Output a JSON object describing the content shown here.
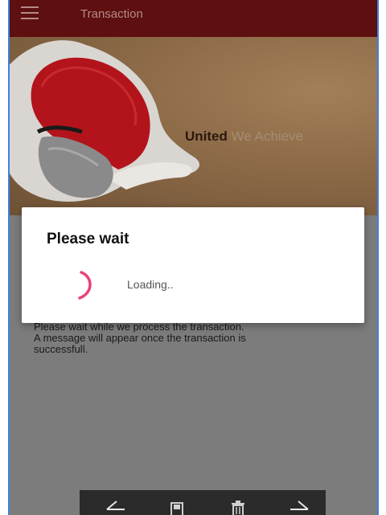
{
  "header": {
    "title": "Transaction"
  },
  "banner": {
    "tagline_part1": "United",
    "tagline_part2": "We Achieve"
  },
  "dialog": {
    "title": "Please wait",
    "loading_text": "Loading.."
  },
  "message": {
    "line1": "Please wait while we process the transaction.",
    "line2": "A message will appear once the transaction is",
    "line3": "successfull."
  },
  "colors": {
    "topbar": "#5e0f0f",
    "spinner": "#e8417c",
    "frame_border": "#3f7fe0"
  },
  "icons": [
    "menu-icon",
    "back-arrow-icon",
    "save-icon",
    "delete-icon",
    "forward-arrow-icon"
  ]
}
